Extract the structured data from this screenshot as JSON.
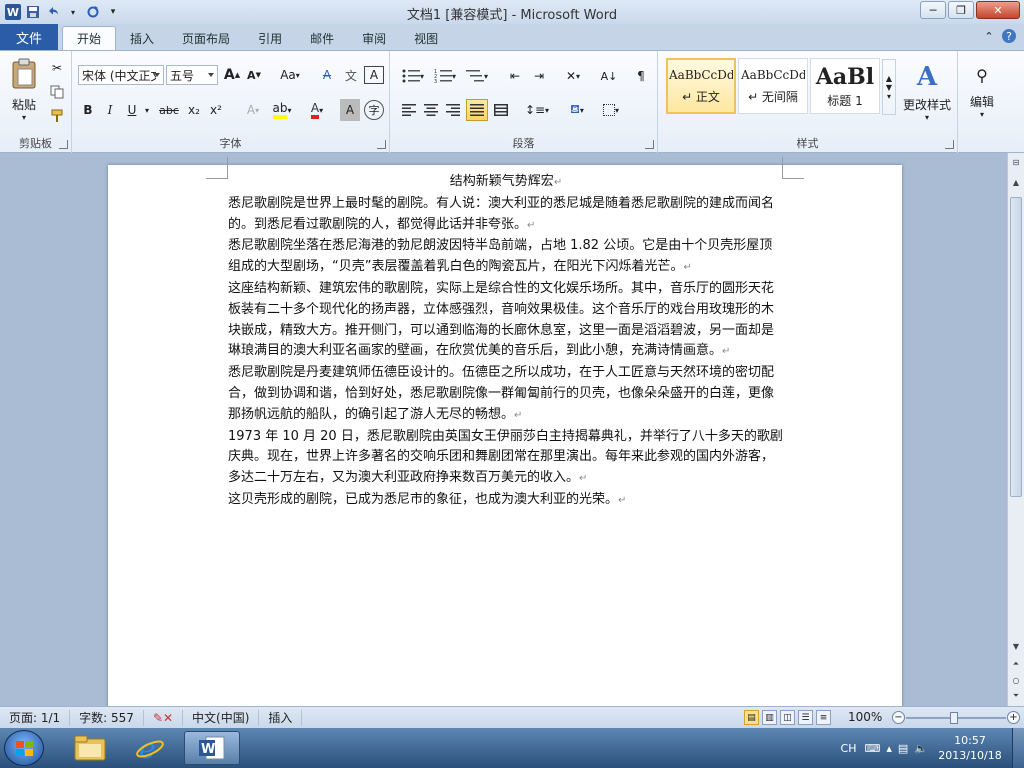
{
  "window": {
    "title": "文档1 [兼容模式] - Microsoft Word",
    "app_letter": "W"
  },
  "tabs": [
    {
      "label": "文件"
    },
    {
      "label": "开始"
    },
    {
      "label": "插入"
    },
    {
      "label": "页面布局"
    },
    {
      "label": "引用"
    },
    {
      "label": "邮件"
    },
    {
      "label": "审阅"
    },
    {
      "label": "视图"
    }
  ],
  "ribbon": {
    "clipboard": {
      "label": "剪贴板",
      "paste_label": "粘贴"
    },
    "font": {
      "label": "字体",
      "font_name": "宋体 (中文正文",
      "font_size": "五号",
      "bold": "B",
      "italic": "I",
      "underline": "U",
      "strike": "abc",
      "sub": "x₂",
      "sup": "x²",
      "grow": "A",
      "shrink": "A",
      "case": "Aa",
      "clear": "A",
      "font_color": "A",
      "shade": "A",
      "encircle": "字"
    },
    "paragraph": {
      "label": "段落"
    },
    "styles": {
      "label": "样式",
      "cards": [
        {
          "sample": "AaBbCcDd",
          "name": "↵ 正文"
        },
        {
          "sample": "AaBbCcDd",
          "name": "↵ 无间隔"
        },
        {
          "sample": "AaBl",
          "name": "标题 1"
        }
      ],
      "change_styles": "更改样式"
    },
    "editing": {
      "label": "编辑"
    }
  },
  "document": {
    "title": "结构新颖气势辉宏",
    "paragraphs": [
      "悉尼歌剧院是世界上最时髦的剧院。有人说：澳大利亚的悉尼城是随着悉尼歌剧院的建成而闻名的。到悉尼看过歌剧院的人，都觉得此话并非夸张。",
      "悉尼歌剧院坐落在悉尼海港的勃尼朗波因特半岛前端，占地 1.82 公顷。它是由十个贝壳形屋顶组成的大型剧场，“贝壳”表层覆盖着乳白色的陶瓷瓦片，在阳光下闪烁着光芒。",
      "这座结构新颖、建筑宏伟的歌剧院，实际上是综合性的文化娱乐场所。其中，音乐厅的圆形天花板装有二十多个现代化的扬声器，立体感强烈，音响效果极佳。这个音乐厅的戏台用玫瑰形的木块嵌成，精致大方。推开侧门，可以通到临海的长廊休息室，这里一面是滔滔碧波，另一面却是琳琅满目的澳大利亚名画家的壁画，在欣赏优美的音乐后，到此小憩，充满诗情画意。",
      "悉尼歌剧院是丹麦建筑师伍德臣设计的。伍德臣之所以成功，在于人工匠意与天然环境的密切配合，做到协调和谐，恰到好处，悉尼歌剧院像一群匍匐前行的贝壳，也像朵朵盛开的白莲，更像那扬帆远航的船队，的确引起了游人无尽的畅想。",
      "1973 年 10 月 20 日，悉尼歌剧院由英国女王伊丽莎白主持揭幕典礼，并举行了八十多天的歌剧庆典。现在，世界上许多著名的交响乐团和舞剧团常在那里演出。每年来此参观的国内外游客，多达二十万左右，又为澳大利亚政府挣来数百万美元的收入。",
      "这贝壳形成的剧院，已成为悉尼市的象征，也成为澳大利亚的光荣。"
    ],
    "para_mark": "↵"
  },
  "status": {
    "page": "页面: 1/1",
    "words": "字数: 557",
    "language": "中文(中国)",
    "mode": "插入",
    "zoom": "100%"
  },
  "taskbar": {
    "ime": "CH",
    "time": "10:57",
    "date": "2013/10/18"
  }
}
